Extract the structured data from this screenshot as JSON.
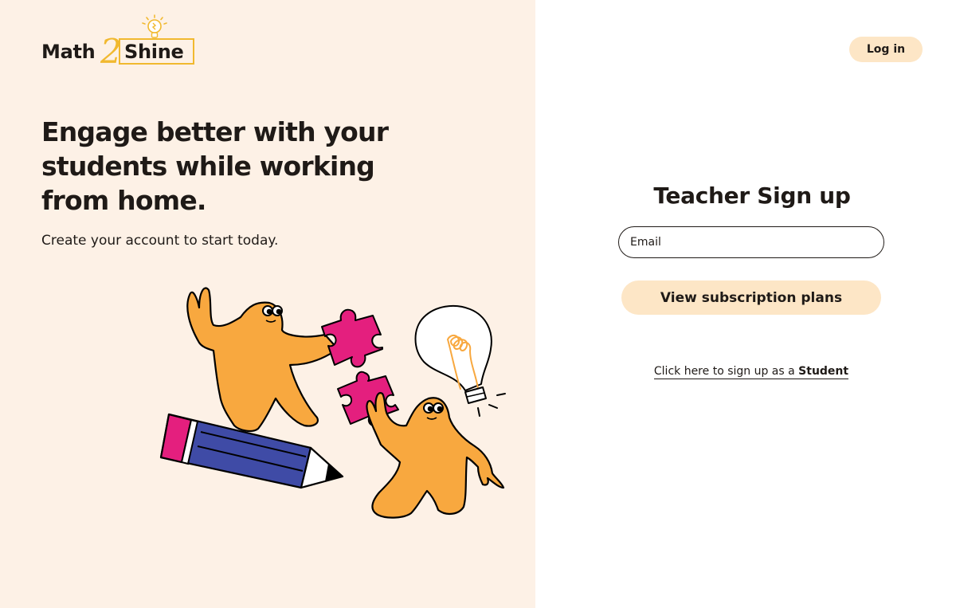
{
  "brand": {
    "name_part1": "Math",
    "name_number": "2",
    "name_part2": "Shine",
    "accent_color": "#f1b92f",
    "logo_icon": "lightbulb-icon"
  },
  "hero": {
    "headline_line1": "Engage better with your",
    "headline_line2": "students while working",
    "headline_line3": "from home.",
    "subtext": "Create your account to start today."
  },
  "colors": {
    "left_background": "#fdf1e6",
    "button_background": "#fde6c6",
    "character": "#f8a83f",
    "puzzle": "#e41f7e",
    "pencil": "#3f4ba6"
  },
  "header": {
    "login_label": "Log in"
  },
  "signup": {
    "title": "Teacher Sign up",
    "email_placeholder": "Email",
    "plans_button_label": "View subscription plans",
    "student_link_prefix": "Click here to sign up as a ",
    "student_link_bold": "Student"
  }
}
